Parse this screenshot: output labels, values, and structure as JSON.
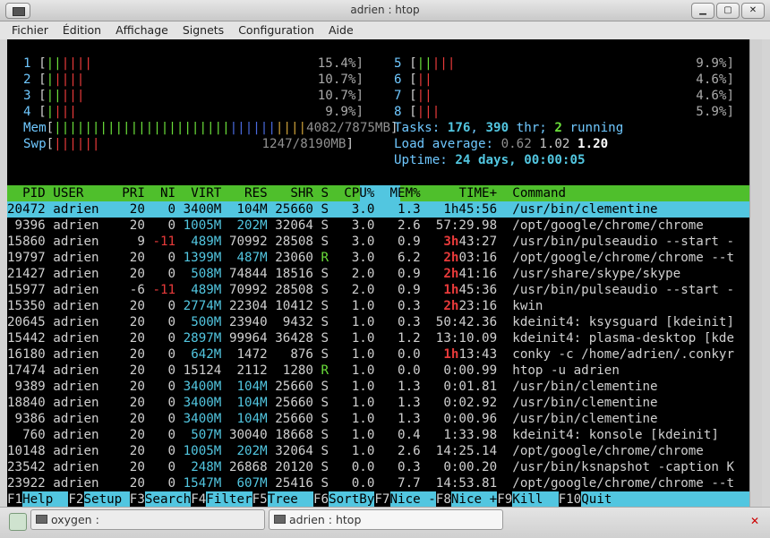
{
  "window": {
    "title": "adrien : htop"
  },
  "menu": [
    "Fichier",
    "Édition",
    "Affichage",
    "Signets",
    "Configuration",
    "Aide"
  ],
  "cpus_left": [
    {
      "n": "1",
      "green": "||",
      "red": "||||",
      "pct": "15.4%"
    },
    {
      "n": "2",
      "green": "|",
      "red": "||||",
      "pct": "10.7%"
    },
    {
      "n": "3",
      "green": "||",
      "red": "|||",
      "pct": "10.7%"
    },
    {
      "n": "4",
      "green": "|",
      "red": "|||",
      "pct": "9.9%"
    }
  ],
  "cpus_right": [
    {
      "n": "5",
      "green": "||",
      "red": "|||",
      "pct": "9.9%"
    },
    {
      "n": "6",
      "green": "",
      "red": "||",
      "pct": "4.6%"
    },
    {
      "n": "7",
      "green": "",
      "red": "||",
      "pct": "4.6%"
    },
    {
      "n": "8",
      "green": "",
      "red": "|||",
      "pct": "5.9%"
    }
  ],
  "mem": {
    "label": "Mem",
    "green": "|||||||||||||||||||||||",
    "blue": "||||||",
    "yellow": "||||",
    "value": "4082/7875MB"
  },
  "swp": {
    "label": "Swp",
    "red": "||||||",
    "value": "1247/8190MB"
  },
  "tasks": {
    "label": "Tasks: ",
    "count": "176",
    "sep": ", ",
    "thr": "390",
    "thr_label": " thr; ",
    "running": "2",
    "running_label": " running"
  },
  "load": {
    "label": "Load average: ",
    "l1": "0.62",
    "l5": "1.02",
    "l15": "1.20"
  },
  "uptime": {
    "label": "Uptime: ",
    "value": "24 days, 00:00:05"
  },
  "columns": [
    "PID",
    "USER",
    "PRI",
    "NI",
    "VIRT",
    "RES",
    "SHR",
    "S",
    "CPU%",
    "MEM%",
    "TIME+",
    "Command"
  ],
  "processes": [
    {
      "pid": "20472",
      "user": "adrien",
      "pri": "20",
      "ni": "0",
      "virt": "3400M",
      "res": "104M",
      "shr": "25660",
      "s": "S",
      "cpu": "3.0",
      "mem": "1.3",
      "time_h": "",
      "time": "1h45:56",
      "cmd": "/usr/bin/clementine"
    },
    {
      "pid": "9396",
      "user": "adrien",
      "pri": "20",
      "ni": "0",
      "virt": "1005M",
      "res": "202M",
      "shr": "32064",
      "s": "S",
      "cpu": "3.0",
      "mem": "2.6",
      "time_h": "",
      "time": "57:29.98",
      "cmd": "/opt/google/chrome/chrome"
    },
    {
      "pid": "15860",
      "user": "adrien",
      "pri": "9",
      "ni": "-11",
      "virt": "489M",
      "res": "70992",
      "shr": "28508",
      "s": "S",
      "cpu": "3.0",
      "mem": "0.9",
      "time_h": "3h",
      "time": "43:27",
      "cmd": "/usr/bin/pulseaudio --start -"
    },
    {
      "pid": "19797",
      "user": "adrien",
      "pri": "20",
      "ni": "0",
      "virt": "1399M",
      "res": "487M",
      "shr": "23060",
      "s": "R",
      "cpu": "3.0",
      "mem": "6.2",
      "time_h": "2h",
      "time": "03:16",
      "cmd": "/opt/google/chrome/chrome --t"
    },
    {
      "pid": "21427",
      "user": "adrien",
      "pri": "20",
      "ni": "0",
      "virt": "508M",
      "res": "74844",
      "shr": "18516",
      "s": "S",
      "cpu": "2.0",
      "mem": "0.9",
      "time_h": "2h",
      "time": "41:16",
      "cmd": "/usr/share/skype/skype"
    },
    {
      "pid": "15977",
      "user": "adrien",
      "pri": "-6",
      "ni": "-11",
      "virt": "489M",
      "res": "70992",
      "shr": "28508",
      "s": "S",
      "cpu": "2.0",
      "mem": "0.9",
      "time_h": "1h",
      "time": "45:36",
      "cmd": "/usr/bin/pulseaudio --start -"
    },
    {
      "pid": "15350",
      "user": "adrien",
      "pri": "20",
      "ni": "0",
      "virt": "2774M",
      "res": "22304",
      "shr": "10412",
      "s": "S",
      "cpu": "1.0",
      "mem": "0.3",
      "time_h": "2h",
      "time": "23:16",
      "cmd": "kwin"
    },
    {
      "pid": "20645",
      "user": "adrien",
      "pri": "20",
      "ni": "0",
      "virt": "500M",
      "res": "23940",
      "shr": "9432",
      "s": "S",
      "cpu": "1.0",
      "mem": "0.3",
      "time_h": "",
      "time": "50:42.36",
      "cmd": "kdeinit4: ksysguard [kdeinit]"
    },
    {
      "pid": "15442",
      "user": "adrien",
      "pri": "20",
      "ni": "0",
      "virt": "2897M",
      "res": "99964",
      "shr": "36428",
      "s": "S",
      "cpu": "1.0",
      "mem": "1.2",
      "time_h": "",
      "time": "13:10.09",
      "cmd": "kdeinit4: plasma-desktop [kde"
    },
    {
      "pid": "16180",
      "user": "adrien",
      "pri": "20",
      "ni": "0",
      "virt": "642M",
      "res": "1472",
      "shr": "876",
      "s": "S",
      "cpu": "1.0",
      "mem": "0.0",
      "time_h": "1h",
      "time": "13:43",
      "cmd": "conky -c /home/adrien/.conkyr"
    },
    {
      "pid": "17474",
      "user": "adrien",
      "pri": "20",
      "ni": "0",
      "virt": "15124",
      "res": "2112",
      "shr": "1280",
      "s": "R",
      "cpu": "1.0",
      "mem": "0.0",
      "time_h": "",
      "time": "0:00.99",
      "cmd": "htop -u adrien"
    },
    {
      "pid": "9389",
      "user": "adrien",
      "pri": "20",
      "ni": "0",
      "virt": "3400M",
      "res": "104M",
      "shr": "25660",
      "s": "S",
      "cpu": "1.0",
      "mem": "1.3",
      "time_h": "",
      "time": "0:01.81",
      "cmd": "/usr/bin/clementine"
    },
    {
      "pid": "18840",
      "user": "adrien",
      "pri": "20",
      "ni": "0",
      "virt": "3400M",
      "res": "104M",
      "shr": "25660",
      "s": "S",
      "cpu": "1.0",
      "mem": "1.3",
      "time_h": "",
      "time": "0:02.92",
      "cmd": "/usr/bin/clementine"
    },
    {
      "pid": "9386",
      "user": "adrien",
      "pri": "20",
      "ni": "0",
      "virt": "3400M",
      "res": "104M",
      "shr": "25660",
      "s": "S",
      "cpu": "1.0",
      "mem": "1.3",
      "time_h": "",
      "time": "0:00.96",
      "cmd": "/usr/bin/clementine"
    },
    {
      "pid": "760",
      "user": "adrien",
      "pri": "20",
      "ni": "0",
      "virt": "507M",
      "res": "30040",
      "shr": "18668",
      "s": "S",
      "cpu": "1.0",
      "mem": "0.4",
      "time_h": "",
      "time": "1:33.98",
      "cmd": "kdeinit4: konsole [kdeinit]"
    },
    {
      "pid": "10148",
      "user": "adrien",
      "pri": "20",
      "ni": "0",
      "virt": "1005M",
      "res": "202M",
      "shr": "32064",
      "s": "S",
      "cpu": "1.0",
      "mem": "2.6",
      "time_h": "",
      "time": "14:25.14",
      "cmd": "/opt/google/chrome/chrome"
    },
    {
      "pid": "23542",
      "user": "adrien",
      "pri": "20",
      "ni": "0",
      "virt": "248M",
      "res": "26868",
      "shr": "20120",
      "s": "S",
      "cpu": "0.0",
      "mem": "0.3",
      "time_h": "",
      "time": "0:00.20",
      "cmd": "/usr/bin/ksnapshot -caption K"
    },
    {
      "pid": "23922",
      "user": "adrien",
      "pri": "20",
      "ni": "0",
      "virt": "1547M",
      "res": "607M",
      "shr": "25416",
      "s": "S",
      "cpu": "0.0",
      "mem": "7.7",
      "time_h": "",
      "time": "14:53.81",
      "cmd": "/opt/google/chrome/chrome --t"
    }
  ],
  "fkeys": [
    {
      "k": "F1",
      "v": "Help"
    },
    {
      "k": "F2",
      "v": "Setup"
    },
    {
      "k": "F3",
      "v": "Search"
    },
    {
      "k": "F4",
      "v": "Filter"
    },
    {
      "k": "F5",
      "v": "Tree"
    },
    {
      "k": "F6",
      "v": "SortBy"
    },
    {
      "k": "F7",
      "v": "Nice -"
    },
    {
      "k": "F8",
      "v": "Nice +"
    },
    {
      "k": "F9",
      "v": "Kill"
    },
    {
      "k": "F10",
      "v": "Quit"
    }
  ],
  "taskbar": {
    "task1": "oxygen :",
    "task2": "adrien : htop"
  },
  "colors": {
    "terminal_bg": "#000000",
    "header_green": "#4fbf2c",
    "selection_cyan": "#52c6e0"
  }
}
